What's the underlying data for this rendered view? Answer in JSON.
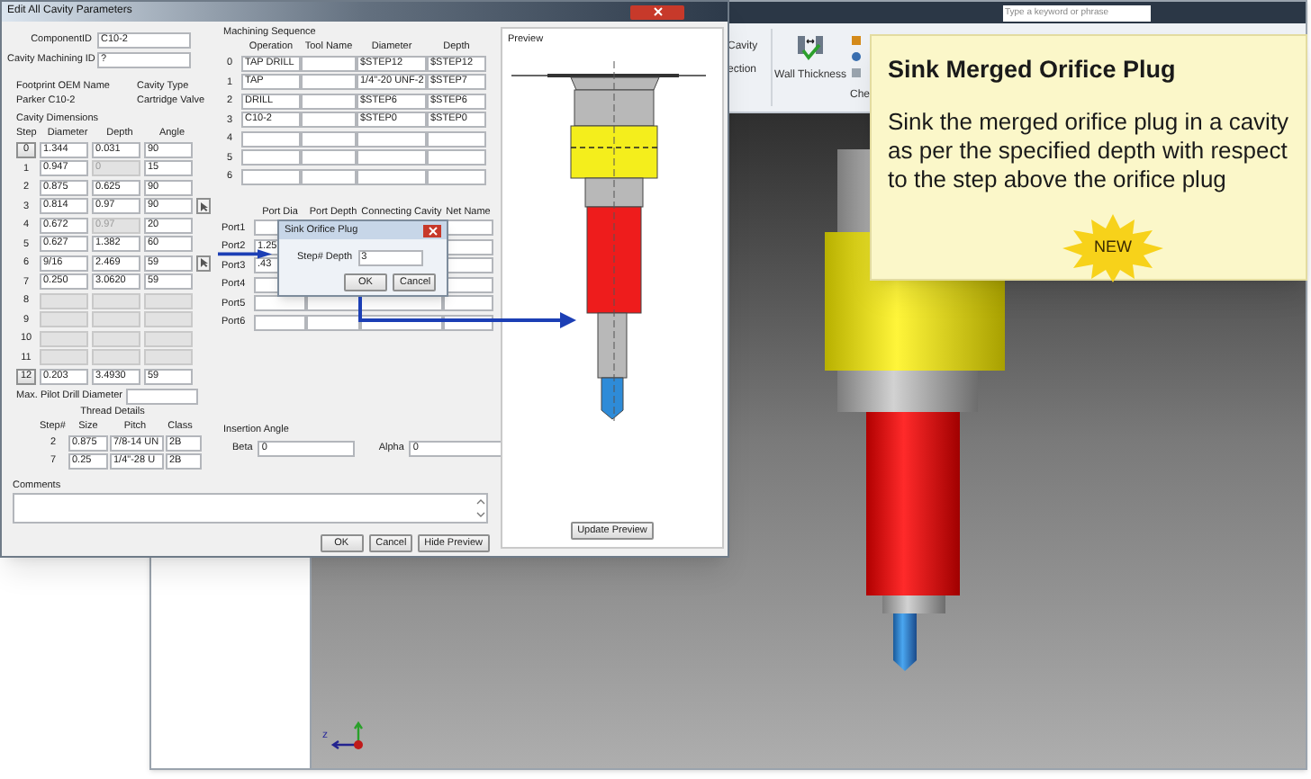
{
  "app": {
    "search": {
      "placeholder": "Type a keyword or phrase"
    },
    "ribbon": {
      "cut_button": [
        "Cavity",
        "ection"
      ],
      "wall_button": "Wall Thickness",
      "group_label": "Che"
    },
    "viewport": {
      "axis_label": "z"
    }
  },
  "window": {
    "title": "Edit All Cavity Parameters"
  },
  "component_id": {
    "label": "ComponentID",
    "value": "C10-2"
  },
  "cavity_machining_id": {
    "label": "Cavity Machining ID",
    "value": "?"
  },
  "footprint": {
    "label": "Footprint OEM Name",
    "value": "Parker C10-2"
  },
  "cavity_type": {
    "label": "Cavity Type",
    "value": "Cartridge Valve"
  },
  "cavity_dimensions": {
    "title": "Cavity Dimensions",
    "columns": [
      "Step",
      "Diameter",
      "Depth",
      "Angle"
    ],
    "rows": [
      {
        "step": "0",
        "kind": "button",
        "diameter": "1.344",
        "depth": "0.031",
        "angle": "90",
        "disabled": false,
        "depth_disabled": false,
        "has_action": false
      },
      {
        "step": "1",
        "kind": "label",
        "diameter": "0.947",
        "depth": "0",
        "angle": "15",
        "disabled": false,
        "depth_disabled": true,
        "has_action": false
      },
      {
        "step": "2",
        "kind": "label",
        "diameter": "0.875",
        "depth": "0.625",
        "angle": "90",
        "disabled": false,
        "depth_disabled": false,
        "has_action": false
      },
      {
        "step": "3",
        "kind": "label",
        "diameter": "0.814",
        "depth": "0.97",
        "angle": "90",
        "disabled": false,
        "depth_disabled": false,
        "has_action": true
      },
      {
        "step": "4",
        "kind": "label",
        "diameter": "0.672",
        "depth": "0.97",
        "angle": "20",
        "disabled": false,
        "depth_disabled": true,
        "has_action": false
      },
      {
        "step": "5",
        "kind": "label",
        "diameter": "0.627",
        "depth": "1.382",
        "angle": "60",
        "disabled": false,
        "depth_disabled": false,
        "has_action": false
      },
      {
        "step": "6",
        "kind": "label",
        "diameter": "9/16",
        "depth": "2.469",
        "angle": "59",
        "disabled": false,
        "depth_disabled": false,
        "has_action": true
      },
      {
        "step": "7",
        "kind": "label",
        "diameter": "0.250",
        "depth": "3.0620",
        "angle": "59",
        "disabled": false,
        "depth_disabled": false,
        "has_action": false
      },
      {
        "step": "8",
        "kind": "label",
        "disabled": true,
        "depth_disabled": false,
        "has_action": false
      },
      {
        "step": "9",
        "kind": "label",
        "disabled": true,
        "depth_disabled": false,
        "has_action": false
      },
      {
        "step": "10",
        "kind": "label",
        "disabled": true,
        "depth_disabled": false,
        "has_action": false
      },
      {
        "step": "11",
        "kind": "label",
        "disabled": true,
        "depth_disabled": false,
        "has_action": false
      },
      {
        "step": "12",
        "kind": "button",
        "diameter": "0.203",
        "depth": "3.4930",
        "angle": "59",
        "disabled": false,
        "depth_disabled": false,
        "has_action": false
      }
    ]
  },
  "max_pilot_drill": {
    "label": "Max. Pilot Drill Diameter"
  },
  "thread_details": {
    "title": "Thread Details",
    "columns": [
      "Step#",
      "Size",
      "Pitch",
      "Class"
    ],
    "rows": [
      {
        "step": "2",
        "size": "0.875",
        "pitch": "7/8-14 UN",
        "class": "2B"
      },
      {
        "step": "7",
        "size": "0.25",
        "pitch": "1/4\"-28 U",
        "class": "2B"
      }
    ]
  },
  "comments": {
    "label": "Comments"
  },
  "machining_sequence": {
    "title": "Machining Sequence",
    "columns": [
      "Operation",
      "Tool Name",
      "Diameter",
      "Depth"
    ],
    "rows": [
      {
        "index": "0",
        "operation": "TAP DRILL",
        "diameter": "$STEP12",
        "depth": "$STEP12"
      },
      {
        "index": "1",
        "operation": "TAP",
        "diameter": "1/4\"-20 UNF-2",
        "depth": "$STEP7"
      },
      {
        "index": "2",
        "operation": "DRILL",
        "diameter": "$STEP6",
        "depth": "$STEP6"
      },
      {
        "index": "3",
        "operation": "C10-2",
        "diameter": "$STEP0",
        "depth": "$STEP0"
      },
      {
        "index": "4"
      },
      {
        "index": "5"
      },
      {
        "index": "6"
      }
    ]
  },
  "ports": {
    "columns": [
      "Port Dia",
      "Port Depth",
      "Connecting Cavity",
      "Net Name"
    ],
    "rows": [
      {
        "label": "Port1"
      },
      {
        "label": "Port2",
        "dia": "1.25"
      },
      {
        "label": "Port3",
        "dia": ".43"
      },
      {
        "label": "Port4"
      },
      {
        "label": "Port5"
      },
      {
        "label": "Port6"
      }
    ]
  },
  "insertion_angle": {
    "title": "Insertion Angle",
    "beta": {
      "label": "Beta",
      "value": "0"
    },
    "alpha": {
      "label": "Alpha",
      "value": "0"
    }
  },
  "preview": {
    "title": "Preview",
    "button": "Update Preview"
  },
  "buttons": [
    "OK",
    "Cancel",
    "Hide Preview"
  ],
  "sub_dialog": {
    "title": "Sink Orifice Plug",
    "field": {
      "label": "Step# Depth",
      "value": "3"
    },
    "buttons": [
      "OK",
      "Cancel"
    ]
  },
  "tooltip": {
    "title": "Sink Merged Orifice Plug",
    "body": "Sink the merged orifice plug in a cavity as per the specified depth with respect to the step above the orifice plug",
    "badge": "NEW"
  }
}
